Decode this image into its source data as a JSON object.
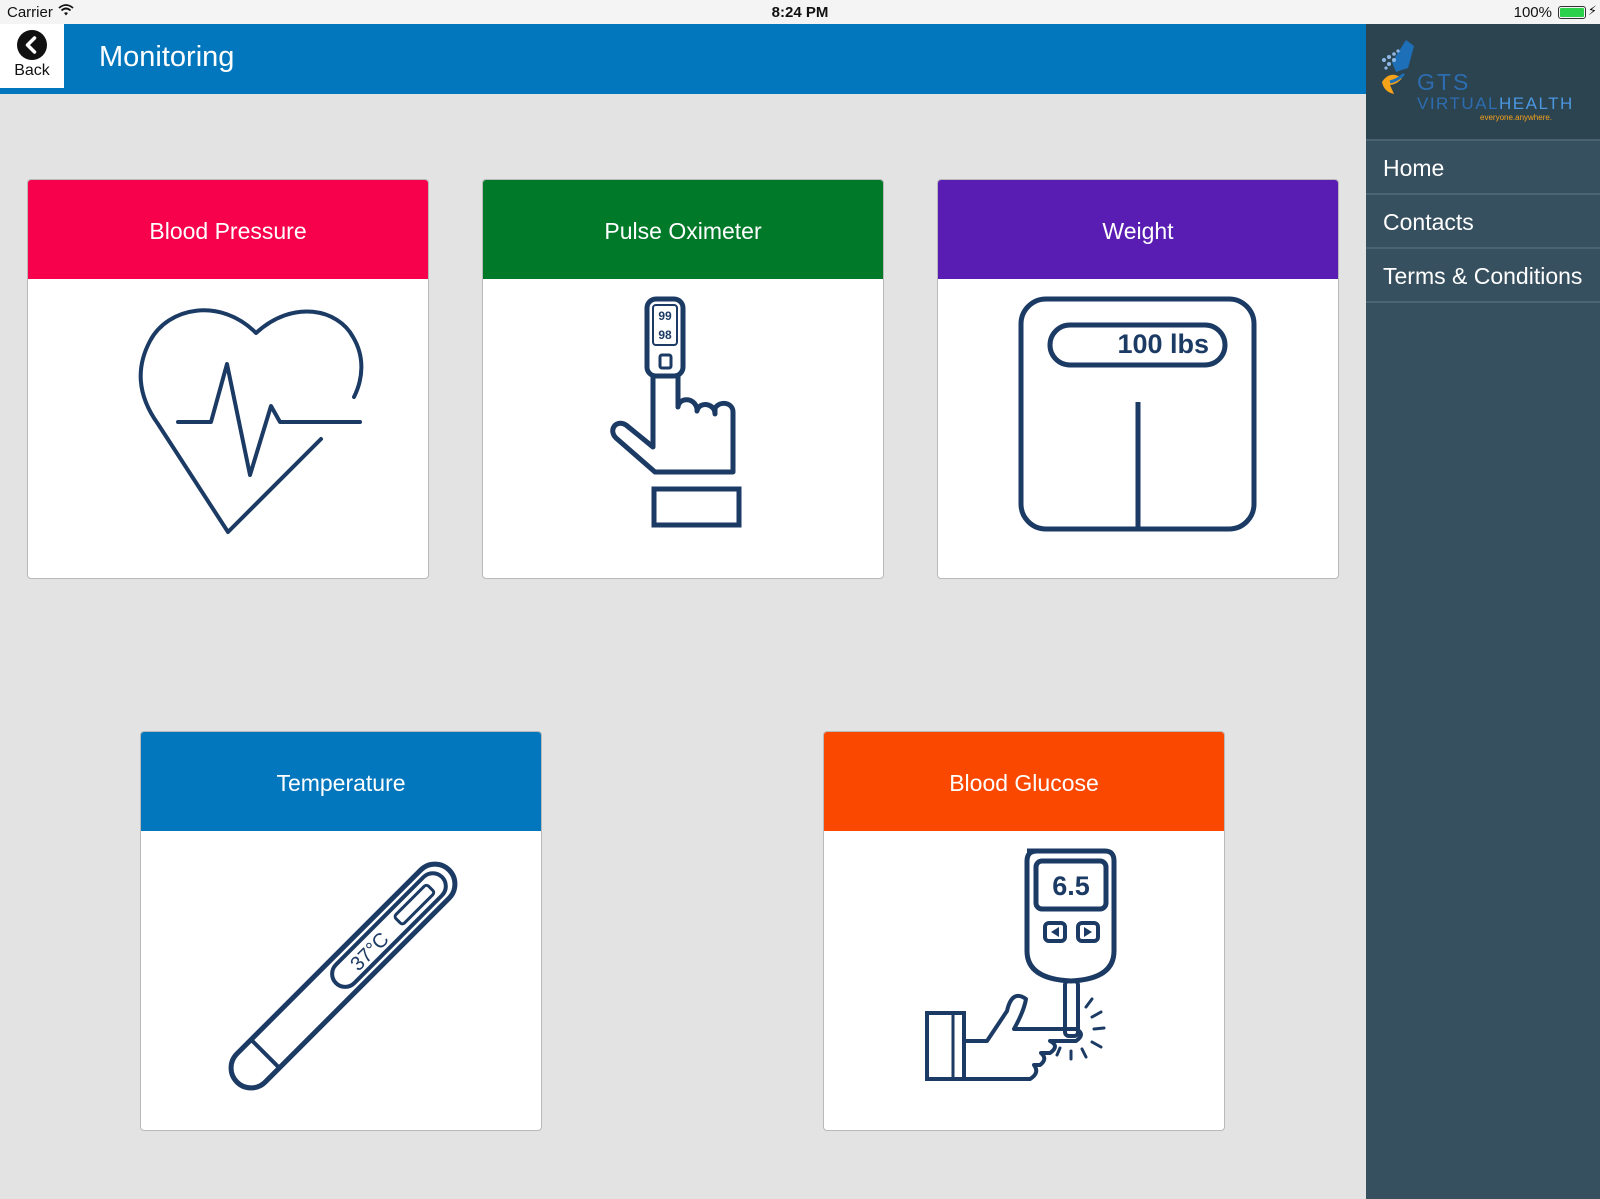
{
  "status_bar": {
    "carrier": "Carrier",
    "time": "8:24 PM",
    "battery": "100%"
  },
  "header": {
    "back_label": "Back",
    "title": "Monitoring"
  },
  "sidebar": {
    "logo": {
      "line1": "GTS",
      "line2_a": "VIRTUAL",
      "line2_b": "HEALTH",
      "tagline": "everyone.anywhere."
    },
    "items": [
      {
        "label": "Home"
      },
      {
        "label": "Contacts"
      },
      {
        "label": "Terms & Conditions"
      }
    ]
  },
  "cards": [
    {
      "label": "Blood Pressure",
      "color": "#f7004c",
      "icon": "heart-pulse-icon"
    },
    {
      "label": "Pulse Oximeter",
      "color": "#007a29",
      "icon": "pulse-oximeter-icon",
      "readings": [
        "99",
        "98"
      ]
    },
    {
      "label": "Weight",
      "color": "#5a1db3",
      "icon": "scale-icon",
      "reading": "100 lbs"
    },
    {
      "label": "Temperature",
      "color": "#0277bd",
      "icon": "thermometer-icon",
      "reading": "37°C"
    },
    {
      "label": "Blood Glucose",
      "color": "#fb4800",
      "icon": "glucose-meter-icon",
      "reading": "6.5"
    }
  ],
  "colors": {
    "header": "#0277bd",
    "sidebar": "#37505f",
    "icon_stroke": "#1b3a64",
    "background": "#e3e3e3"
  }
}
